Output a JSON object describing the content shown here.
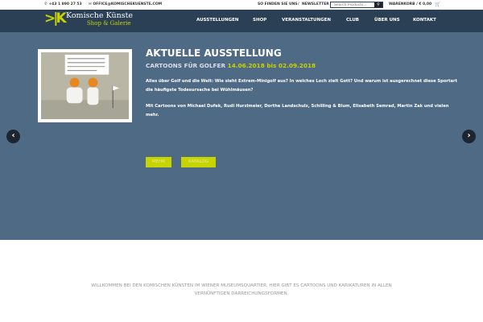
{
  "topbar": {
    "phone": "+43 1 890 27 53",
    "email": "OFFICE@KOMISCHEKUENSTE.COM",
    "find_us": "SO FINDEN SIE UNS",
    "newsletter": "NEWSLETTER",
    "search_placeholder": "Search Products...",
    "cart": "WARENKORB / € 0,00"
  },
  "logo": {
    "line1": "Komische Künste",
    "line2": "Shop & Galerie",
    "mark": "KK"
  },
  "nav": [
    "AUSSTELLUNGEN",
    "SHOP",
    "VERANSTALTUNGEN",
    "CLUB",
    "ÜBER UNS",
    "KONTAKT"
  ],
  "hero": {
    "title": "AKTUELLE AUSSTELLUNG",
    "subtitle": "CARTOONS FÜR GOLFER",
    "dates": "14.06.2018 bis 02.09.2018",
    "para1": "Alles über Golf und die Welt: Wie sieht Extrem-Minigolf aus? In welches Loch zielt Gott? Und warum ist ausgerechnet diese Sportart die häufigste Todesursache bei Wühlmäusen?",
    "para2": "Mit Cartoons von Michael Dufek, Rudi Hurzlmeier, Dorthe Landschulz, Schilling & Blum, Elisabeth Semrad, Martin Zak und vielen mehr.",
    "more": "MEHR",
    "catalog": "KATALOG",
    "prev": "‹",
    "next": "›"
  },
  "welcome": "WILLKOMMEN BEI DEN KOMISCHEN KÜNSTEN IM WIENER MUSEUMSQUARTIER. HIER GIBT ES CARTOONS UND KARIKATUREN IN ALLEN VERNÜNFTIGEN DARREICHUNGSFORMEN."
}
